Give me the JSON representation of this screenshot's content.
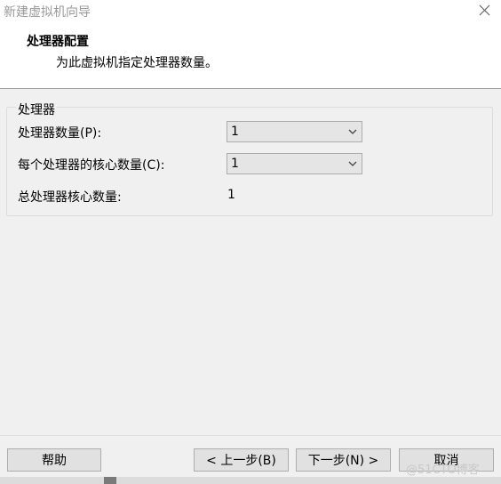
{
  "window": {
    "title": "新建虚拟机向导"
  },
  "header": {
    "title": "处理器配置",
    "subtitle": "为此虚拟机指定处理器数量。"
  },
  "processor_group": {
    "legend": "处理器",
    "count_label": "处理器数量(P):",
    "count_value": "1",
    "cores_label": "每个处理器的核心数量(C):",
    "cores_value": "1",
    "total_label": "总处理器核心数量:",
    "total_value": "1"
  },
  "buttons": {
    "help": "帮助",
    "back": "< 上一步(B)",
    "next": "下一步(N) >",
    "cancel": "取消"
  },
  "watermark": "@51CTO博客",
  "icons": {
    "close": "close-icon",
    "dropdown": "chevron-down-icon"
  }
}
